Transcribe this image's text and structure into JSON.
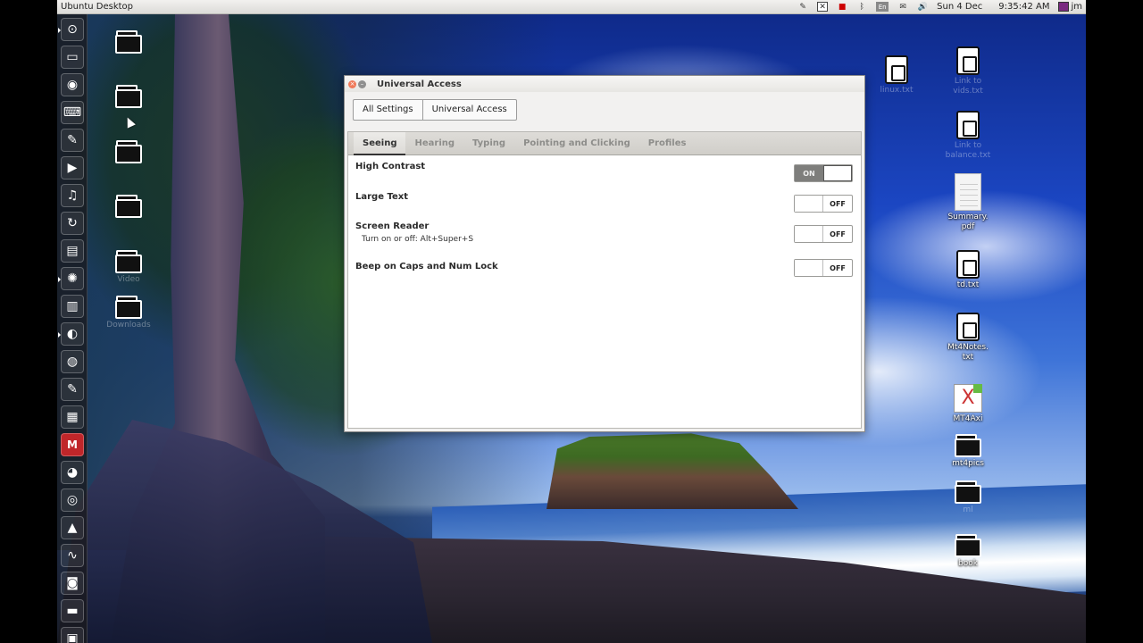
{
  "top_panel": {
    "title": "Ubuntu Desktop",
    "date": "Sun 4 Dec",
    "time": "9:35:42 AM",
    "lang": "En",
    "user": "jm"
  },
  "launcher": {
    "items": [
      "dash",
      "workspace",
      "browser",
      "keyboard",
      "settings",
      "terminal",
      "music",
      "update",
      "notes",
      "gimp",
      "archive",
      "firefox",
      "chromium",
      "text-editor",
      "calculator",
      "gmail",
      "network",
      "media-player",
      "presentation",
      "system-monitor",
      "disk-utility",
      "tray",
      "app"
    ]
  },
  "desktop_left": {
    "folders": [
      "",
      "",
      "",
      "",
      "",
      ""
    ],
    "labels": [
      "",
      "",
      "",
      "",
      "Video",
      "Downloads"
    ]
  },
  "desktop_right": {
    "items": [
      {
        "label": "linux.txt",
        "type": "text",
        "faint": true
      },
      {
        "label": "Link to\nvids.txt",
        "type": "text",
        "faint": true
      },
      {
        "label": "Link to\nbalance.txt",
        "type": "text",
        "faint": true
      },
      {
        "label": "Summary.\npdf",
        "type": "pdf",
        "faint": false
      },
      {
        "label": "td.txt",
        "type": "text",
        "faint": false
      },
      {
        "label": "Mt4Notes.\ntxt",
        "type": "text",
        "faint": false
      },
      {
        "label": "MT4Axi",
        "type": "ods",
        "faint": false
      },
      {
        "label": "mt4pics",
        "type": "folder",
        "faint": false
      },
      {
        "label": "ml",
        "type": "folder",
        "faint": true
      },
      {
        "label": "book",
        "type": "folder",
        "faint": false
      }
    ]
  },
  "dialog": {
    "title": "Universal Access",
    "breadcrumbs": [
      "All Settings",
      "Universal Access"
    ],
    "tabs": [
      "Seeing",
      "Hearing",
      "Typing",
      "Pointing and Clicking",
      "Profiles"
    ],
    "active_tab": "Seeing",
    "rows": [
      {
        "label": "High Contrast",
        "state": "ON"
      },
      {
        "label": "Large Text",
        "state": "OFF"
      },
      {
        "label": "Screen Reader",
        "sub": "Turn on or off:  Alt+Super+S",
        "state": "OFF"
      },
      {
        "label": "Beep on Caps and Num Lock",
        "state": "OFF"
      }
    ],
    "toggle_on_text": "ON",
    "toggle_off_text": "OFF"
  }
}
